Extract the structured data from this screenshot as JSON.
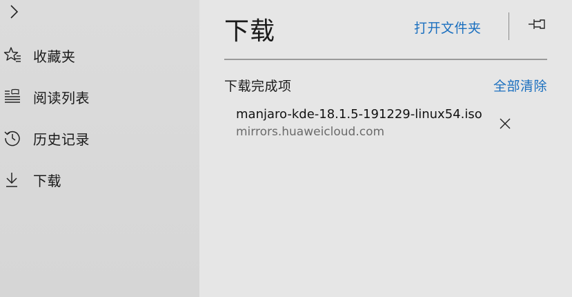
{
  "sidebar": {
    "expand_icon": "chevron-right-icon",
    "items": [
      {
        "label": "收藏夹",
        "icon": "favorites-star-icon"
      },
      {
        "label": "阅读列表",
        "icon": "reading-list-icon"
      },
      {
        "label": "历史记录",
        "icon": "history-icon"
      },
      {
        "label": "下载",
        "icon": "download-arrow-icon"
      }
    ]
  },
  "pane": {
    "title": "下载",
    "open_folder_label": "打开文件夹",
    "pin_icon": "pin-icon",
    "section_title": "下载完成项",
    "clear_all_label": "全部清除",
    "downloads": [
      {
        "file_name": "manjaro-kde-18.1.5-191229-linux54.iso",
        "source": "mirrors.huaweicloud.com",
        "remove_icon": "close-icon"
      }
    ]
  },
  "colors": {
    "accent": "#1a6fbf",
    "sidebar_bg": "#d9d9d9",
    "pane_bg": "#e6e6e6",
    "secondary_text": "#6b6b6b"
  }
}
